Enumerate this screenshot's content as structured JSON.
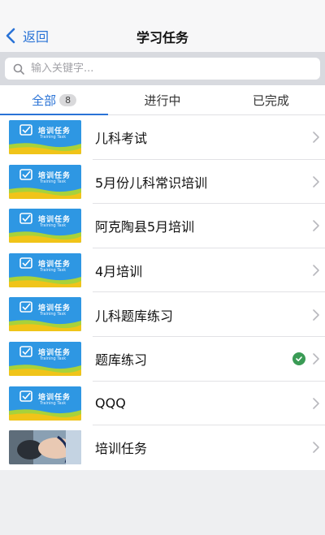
{
  "navbar": {
    "back_label": "返回",
    "title": "学习任务",
    "accent_color": "#2a73d6"
  },
  "search": {
    "placeholder": "输入关键字..."
  },
  "tabs": [
    {
      "label": "全部",
      "count": "8",
      "active": true
    },
    {
      "label": "进行中",
      "active": false
    },
    {
      "label": "已完成",
      "active": false
    }
  ],
  "thumbnail": {
    "title": "培训任务",
    "subtitle": "Training Task"
  },
  "tasks": [
    {
      "title": "儿科考试",
      "thumbnail": "training-task-banner",
      "completed": false
    },
    {
      "title": "5月份儿科常识培训",
      "thumbnail": "training-task-banner",
      "completed": false
    },
    {
      "title": "阿克陶县5月培训",
      "thumbnail": "training-task-banner",
      "completed": false
    },
    {
      "title": "4月培训",
      "thumbnail": "training-task-banner",
      "completed": false
    },
    {
      "title": "儿科题库练习",
      "thumbnail": "training-task-banner",
      "completed": false
    },
    {
      "title": "题库练习",
      "thumbnail": "training-task-banner",
      "completed": true
    },
    {
      "title": "QQQ",
      "thumbnail": "training-task-banner",
      "completed": false
    },
    {
      "title": "培训任务",
      "thumbnail": "medical-photo",
      "completed": false
    }
  ],
  "icons": {
    "back": "chevron-left-icon",
    "search": "search-icon",
    "row_arrow": "chevron-right-icon",
    "completed": "check-circle-icon"
  },
  "colors": {
    "completed": "#3a9b55",
    "banner_blue": "#2e97e3",
    "banner_green": "#a8d23a"
  }
}
